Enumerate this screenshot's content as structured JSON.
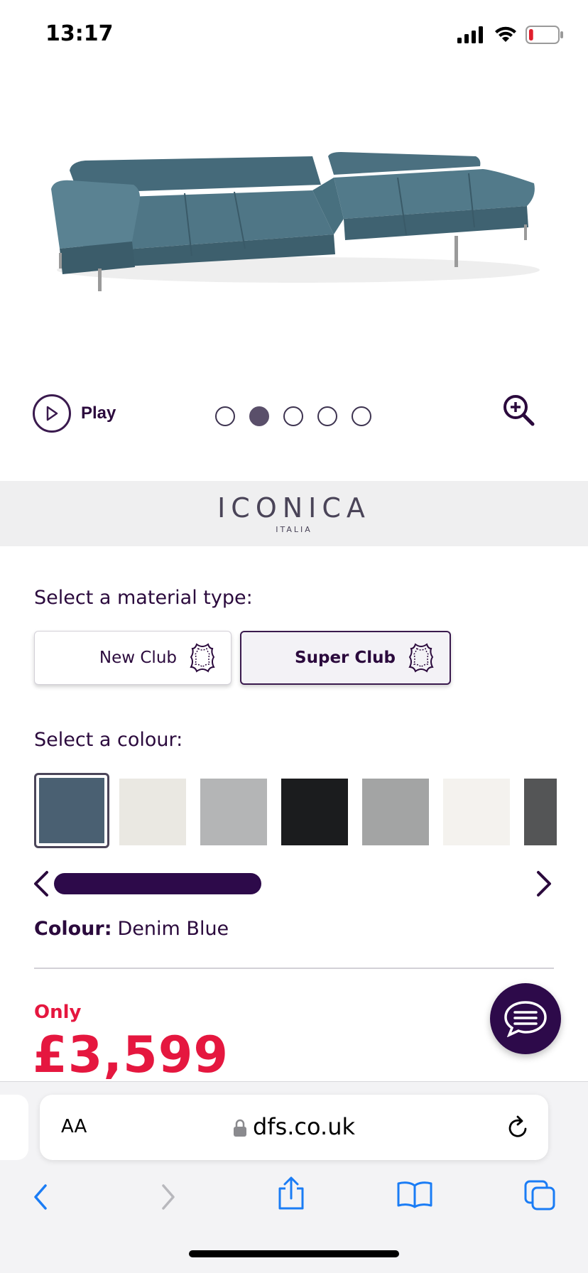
{
  "status_bar": {
    "time": "13:17",
    "battery_level": 0.15
  },
  "hero": {
    "image": "corner-sofa-denim-blue",
    "play_label": "Play",
    "slide_count": 5,
    "active_slide": 2
  },
  "brand": {
    "name": "ICONICA",
    "subtitle": "ITALIA"
  },
  "material": {
    "heading": "Select a material type:",
    "options": [
      {
        "label": "New Club",
        "icon": "leather-hide-icon",
        "selected": false
      },
      {
        "label": "Super Club",
        "icon": "leather-hide-icon",
        "selected": true
      }
    ]
  },
  "colour": {
    "heading": "Select a colour:",
    "swatches": [
      {
        "color": "#4a6072",
        "selected": true
      },
      {
        "color": "#eae8e2",
        "selected": false
      },
      {
        "color": "#b4b5b6",
        "selected": false
      },
      {
        "color": "#1b1c1e",
        "selected": false
      },
      {
        "color": "#a3a4a4",
        "selected": false
      },
      {
        "color": "#f4f2ee",
        "selected": false
      },
      {
        "color": "#545556",
        "selected": false
      }
    ],
    "label_prefix": "Colour:",
    "selected_name": "Denim Blue"
  },
  "price": {
    "prefix": "Only",
    "amount": "£3,599"
  },
  "browser": {
    "aa_label": "AA",
    "url": "dfs.co.uk"
  },
  "colors": {
    "brand_purple": "#2d0a4a",
    "price_red": "#e5173f",
    "ios_blue": "#1a7cf5"
  }
}
